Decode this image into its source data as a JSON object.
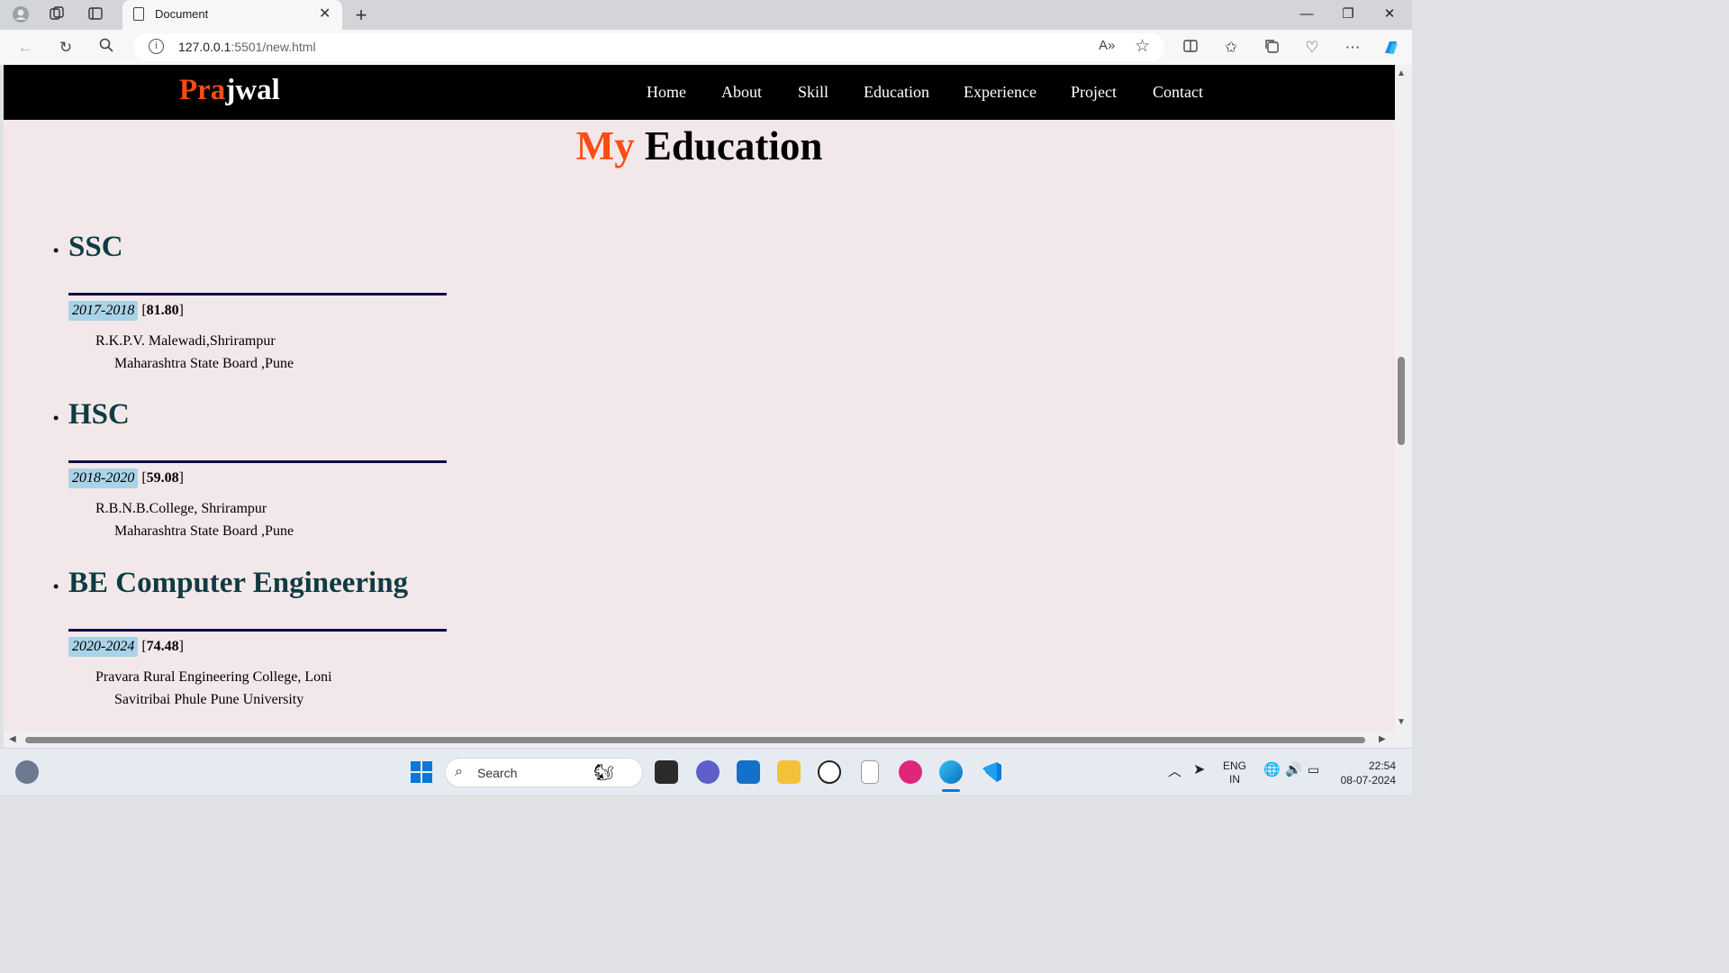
{
  "browser": {
    "tab_title": "Document",
    "tab_close": "✕",
    "new_tab": "+",
    "url_host": "127.0.0.1",
    "url_rest": ":5501/new.html",
    "minimize": "—",
    "restore": "❐",
    "close": "✕"
  },
  "site": {
    "logo_accent": "Pra",
    "logo_rest": "jwal",
    "nav": [
      "Home",
      "About",
      "Skill",
      "Education",
      "Experience",
      "Project",
      "Contact"
    ],
    "heading_accent": "My",
    "heading_rest": " Education"
  },
  "education": [
    {
      "name": "SSC",
      "years": "2017-2018",
      "score": "81.80",
      "school": "R.K.P.V. Malewadi,Shrirampur",
      "board": "Maharashtra State Board ,Pune"
    },
    {
      "name": "HSC",
      "years": "2018-2020",
      "score": "59.08",
      "school": "R.B.N.B.College, Shrirampur",
      "board": "Maharashtra State Board ,Pune"
    },
    {
      "name": "BE Computer Engineering",
      "years": "2020-2024",
      "score": "74.48",
      "school": "Pravara Rural Engineering College, Loni",
      "board": "Savitribai Phule Pune University"
    }
  ],
  "taskbar": {
    "search_label": "Search",
    "lang_top": "ENG",
    "lang_bottom": "IN",
    "time": "22:54",
    "date": "08-07-2024"
  },
  "colors": {
    "accent": "#ff4b14",
    "navbar": "#000000",
    "page_bg": "#f3e8e9",
    "heading_teal": "#0f3b43",
    "year_badge": "#a9d3e8",
    "rule": "#0b0b4a"
  }
}
